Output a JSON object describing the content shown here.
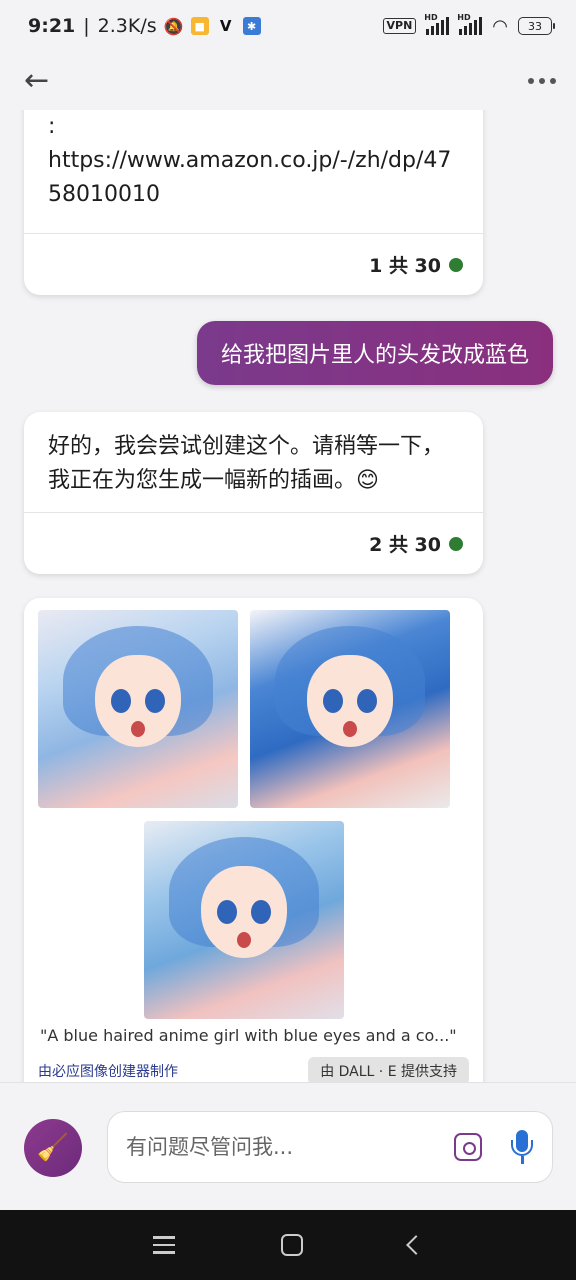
{
  "status_bar": {
    "time": "9:21",
    "speed": "2.3K/s",
    "vpn": "VPN",
    "hd1": "HD",
    "hd2": "HD",
    "battery": "33"
  },
  "nav": {
    "back_icon": "arrow-left-icon",
    "more_icon": "more-dots-icon"
  },
  "messages": [
    {
      "role": "bot",
      "text": ":\nhttps://www.amazon.co.jp/-/zh/dp/4758010010",
      "counter": "1 共 30",
      "status_color": "#2e7d32"
    },
    {
      "role": "user",
      "text": "给我把图片里人的头发改成蓝色"
    },
    {
      "role": "bot",
      "text": "好的，我会尝试创建这个。请稍等一下，我正在为您生成一幅新的插画。😊",
      "counter": "2 共 30",
      "status_color": "#2e7d32"
    },
    {
      "role": "bot",
      "caption": "\"A blue haired anime girl with blue eyes and a co...\"",
      "made_by": "由必应图像创建器制作",
      "powered_by": "由 DALL · E 提供支持"
    }
  ],
  "input": {
    "placeholder": "有问题尽管问我..."
  },
  "colors": {
    "accent": "#7b3a8c",
    "mic": "#2a6fd6",
    "status_dot": "#2e7d32"
  }
}
